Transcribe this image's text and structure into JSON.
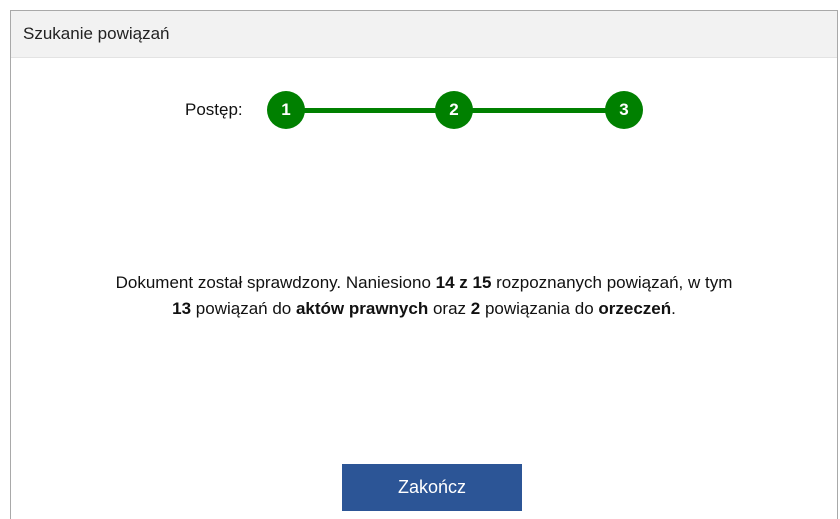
{
  "dialog": {
    "title": "Szukanie powiązań"
  },
  "progress": {
    "label": "Postęp:",
    "steps": [
      {
        "number": "1",
        "state": "completed"
      },
      {
        "number": "2",
        "state": "completed"
      },
      {
        "number": "3",
        "state": "completed"
      }
    ],
    "color": "#008000"
  },
  "message": {
    "line1_prefix": "Dokument został sprawdzony. Naniesiono ",
    "applied_count": "14 z 15",
    "line1_suffix": " rozpoznanych powiązań, w tym",
    "legal_acts_count": "13",
    "line2_mid1": " powiązań do ",
    "legal_acts_label": "aktów prawnych",
    "line2_mid2": " oraz ",
    "rulings_count": "2",
    "line2_mid3": " powiązania do ",
    "rulings_label": "orzeczeń",
    "line2_end": "."
  },
  "actions": {
    "finish_label": "Zakończ",
    "finish_color": "#2c5596"
  }
}
